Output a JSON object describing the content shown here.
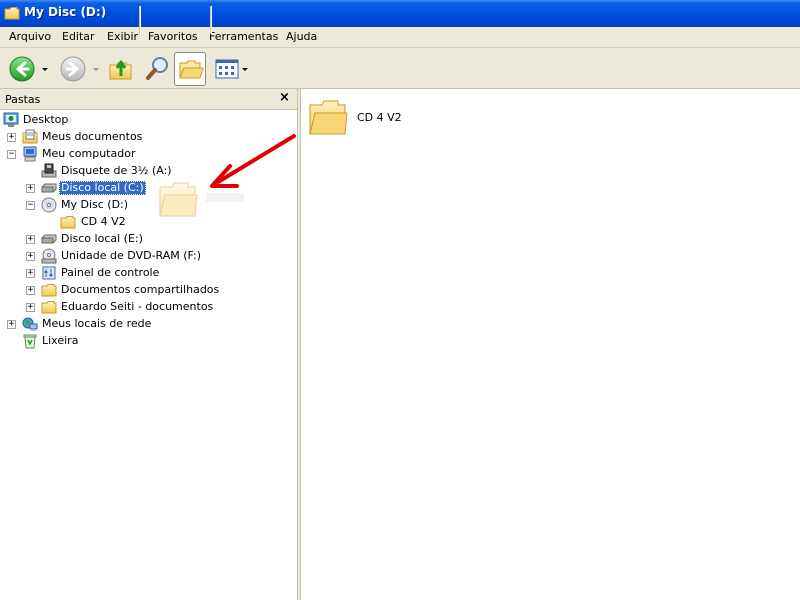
{
  "window": {
    "title": "My Disc (D:)"
  },
  "menu": [
    "Arquivo",
    "Editar",
    "Exibir",
    "Favoritos",
    "Ferramentas",
    "Ajuda"
  ],
  "toolbar": {
    "buttons": [
      "back-icon",
      "forward-icon",
      "up-folder-icon",
      "search-icon",
      "folders-icon",
      "views-icon"
    ],
    "active": "folders"
  },
  "folders_pane": {
    "title": "Pastas",
    "close_glyph": "×",
    "tree": [
      {
        "label": "Desktop",
        "icon": "desktop-icon",
        "expander": ""
      },
      {
        "label": "Meus documentos",
        "icon": "my-documents-icon",
        "expander": "+"
      },
      {
        "label": "Meu computador",
        "icon": "my-computer-icon",
        "expander": "−"
      },
      {
        "label": "Disquete de 3½ (A:)",
        "icon": "floppy-drive-icon",
        "expander": ""
      },
      {
        "label": "Disco local (C:)",
        "icon": "hard-drive-icon",
        "expander": "+",
        "selected": true
      },
      {
        "label": "My Disc (D:)",
        "icon": "cd-drive-icon",
        "expander": "−"
      },
      {
        "label": "CD 4 V2",
        "icon": "folder-icon",
        "expander": ""
      },
      {
        "label": "Disco local (E:)",
        "icon": "hard-drive-icon",
        "expander": "+"
      },
      {
        "label": "Unidade de DVD-RAM (F:)",
        "icon": "dvd-drive-icon",
        "expander": "+"
      },
      {
        "label": "Painel de controle",
        "icon": "control-panel-icon",
        "expander": "+"
      },
      {
        "label": "Documentos compartilhados",
        "icon": "folder-icon",
        "expander": "+"
      },
      {
        "label": "Eduardo Seiti - documentos",
        "icon": "folder-icon",
        "expander": "+"
      },
      {
        "label": "Meus locais de rede",
        "icon": "network-places-icon",
        "expander": "+"
      },
      {
        "label": "Lixeira",
        "icon": "recycle-bin-icon",
        "expander": ""
      }
    ]
  },
  "content": {
    "items": [
      {
        "label": "CD 4 V2",
        "icon": "folder-icon"
      }
    ]
  },
  "annotation": {
    "icon": "red-arrow-icon",
    "color": "#e00000"
  },
  "colors": {
    "title_blue": "#0050e0",
    "selection": "#316ac5",
    "chrome": "#ece9d8",
    "folder_yellow": "#f7d675"
  }
}
